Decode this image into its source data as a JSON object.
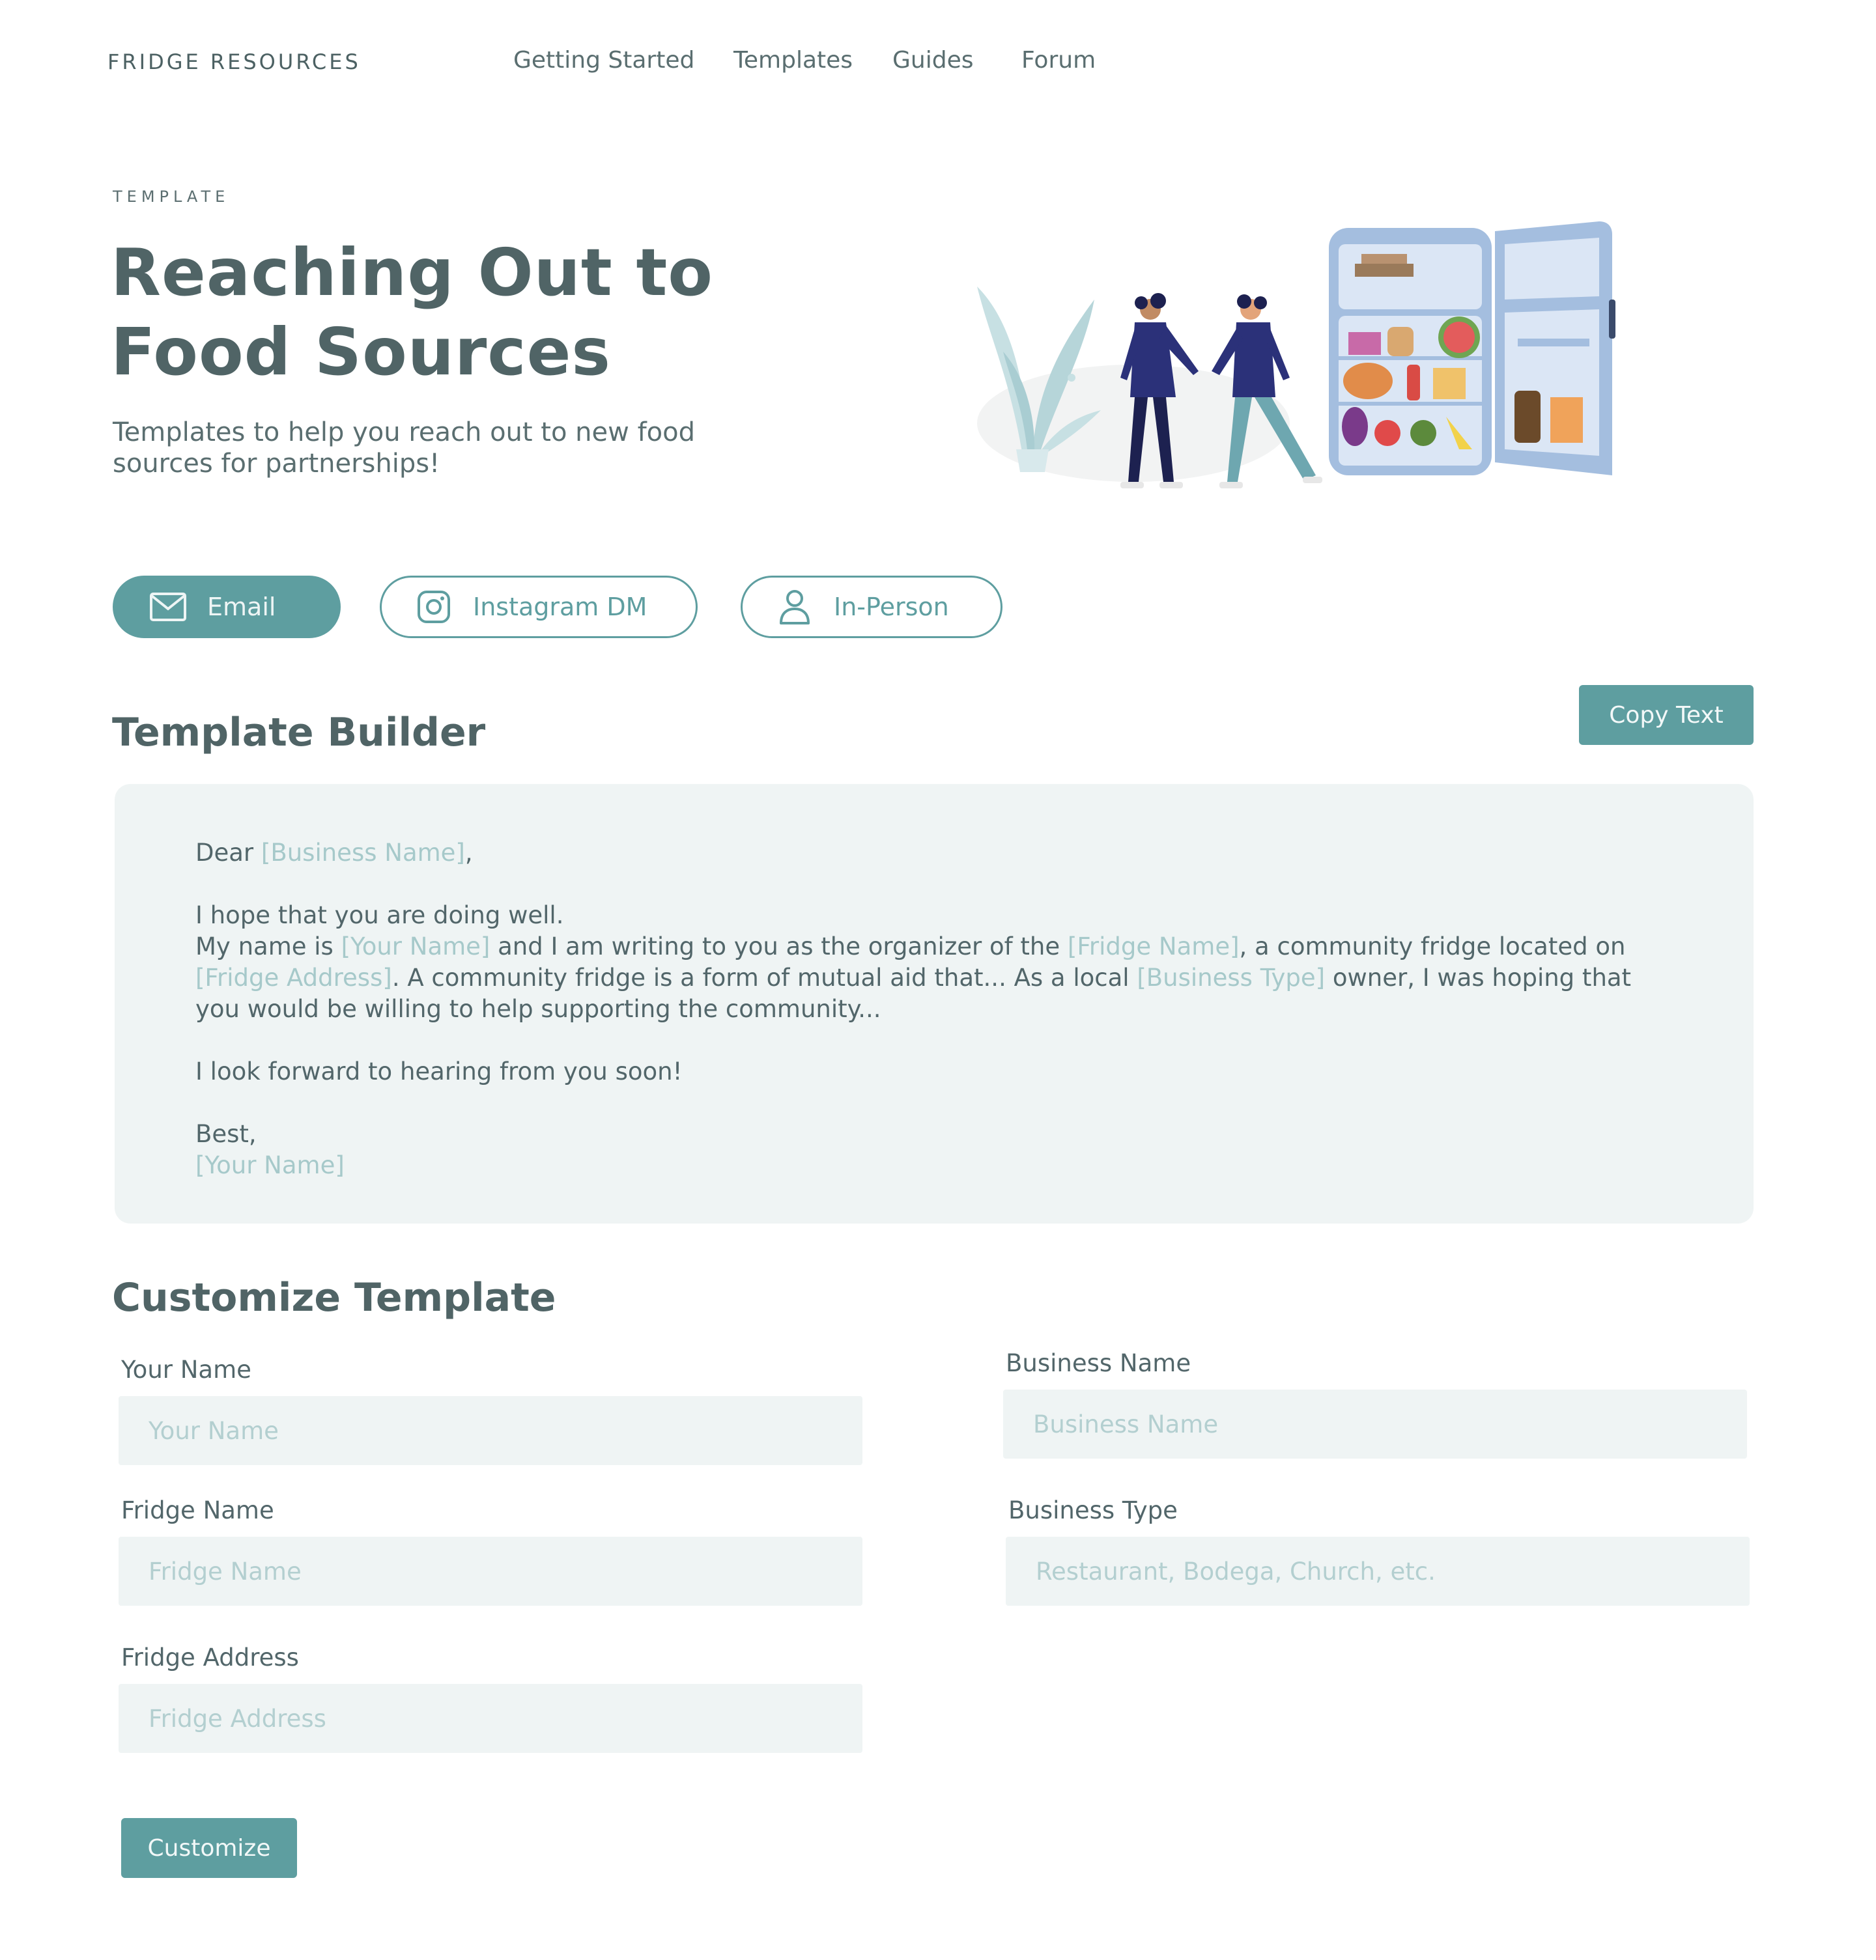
{
  "nav": {
    "brand": "FRIDGE RESOURCES",
    "links": [
      "Getting Started",
      "Templates",
      "Guides",
      "Forum"
    ]
  },
  "hero": {
    "eyebrow": "TEMPLATE",
    "title_line1": "Reaching Out to",
    "title_line2": "Food Sources",
    "subtitle_line1": "Templates to help you reach out to new food",
    "subtitle_line2": "sources for partnerships!",
    "illustration": "two-people-at-community-fridge-illustration"
  },
  "tabs": [
    {
      "label": "Email",
      "icon": "mail-icon",
      "active": true
    },
    {
      "label": "Instagram DM",
      "icon": "instagram-icon",
      "active": false
    },
    {
      "label": "In-Person",
      "icon": "person-icon",
      "active": false
    }
  ],
  "builder": {
    "heading": "Template Builder",
    "copy_label": "Copy Text",
    "letter": {
      "greeting": "Dear ",
      "ph_business_name": "[Business Name]",
      "greeting_end": ",",
      "line_hope": "I hope that you are doing well.",
      "my_name_is": "My name is ",
      "ph_your_name": "[Your Name]",
      "writing": " and I am writing to you as the organizer of the ",
      "ph_fridge_name": "[Fridge Name]",
      "located": ", a community fridge located on ",
      "ph_fridge_address": "[Fridge Address]",
      "mutual_aid": ". A community fridge is a form of mutual aid that... As a local ",
      "ph_business_type": "[Business Type]",
      "owner": " owner, I was hoping that you would be willing to help supporting the community...",
      "look_forward": "I look forward to hearing from you soon!",
      "sign_off": "Best,",
      "ph_signature": "[Your Name]"
    }
  },
  "customize": {
    "heading": "Customize Template",
    "fields": {
      "your_name": {
        "label": "Your Name",
        "placeholder": "Your Name",
        "value": ""
      },
      "business_name": {
        "label": "Business Name",
        "placeholder": "Business Name",
        "value": ""
      },
      "fridge_name": {
        "label": "Fridge Name",
        "placeholder": "Fridge Name",
        "value": ""
      },
      "business_type": {
        "label": "Business Type",
        "placeholder": "Restaurant, Bodega, Church, etc.",
        "value": ""
      },
      "fridge_address": {
        "label": "Fridge Address",
        "placeholder": "Fridge Address",
        "value": ""
      }
    },
    "submit_label": "Customize"
  },
  "colors": {
    "accent": "#5e9ea0",
    "heading": "#506466",
    "panel": "#eff4f4",
    "placeholder": "#a6c9ca"
  }
}
